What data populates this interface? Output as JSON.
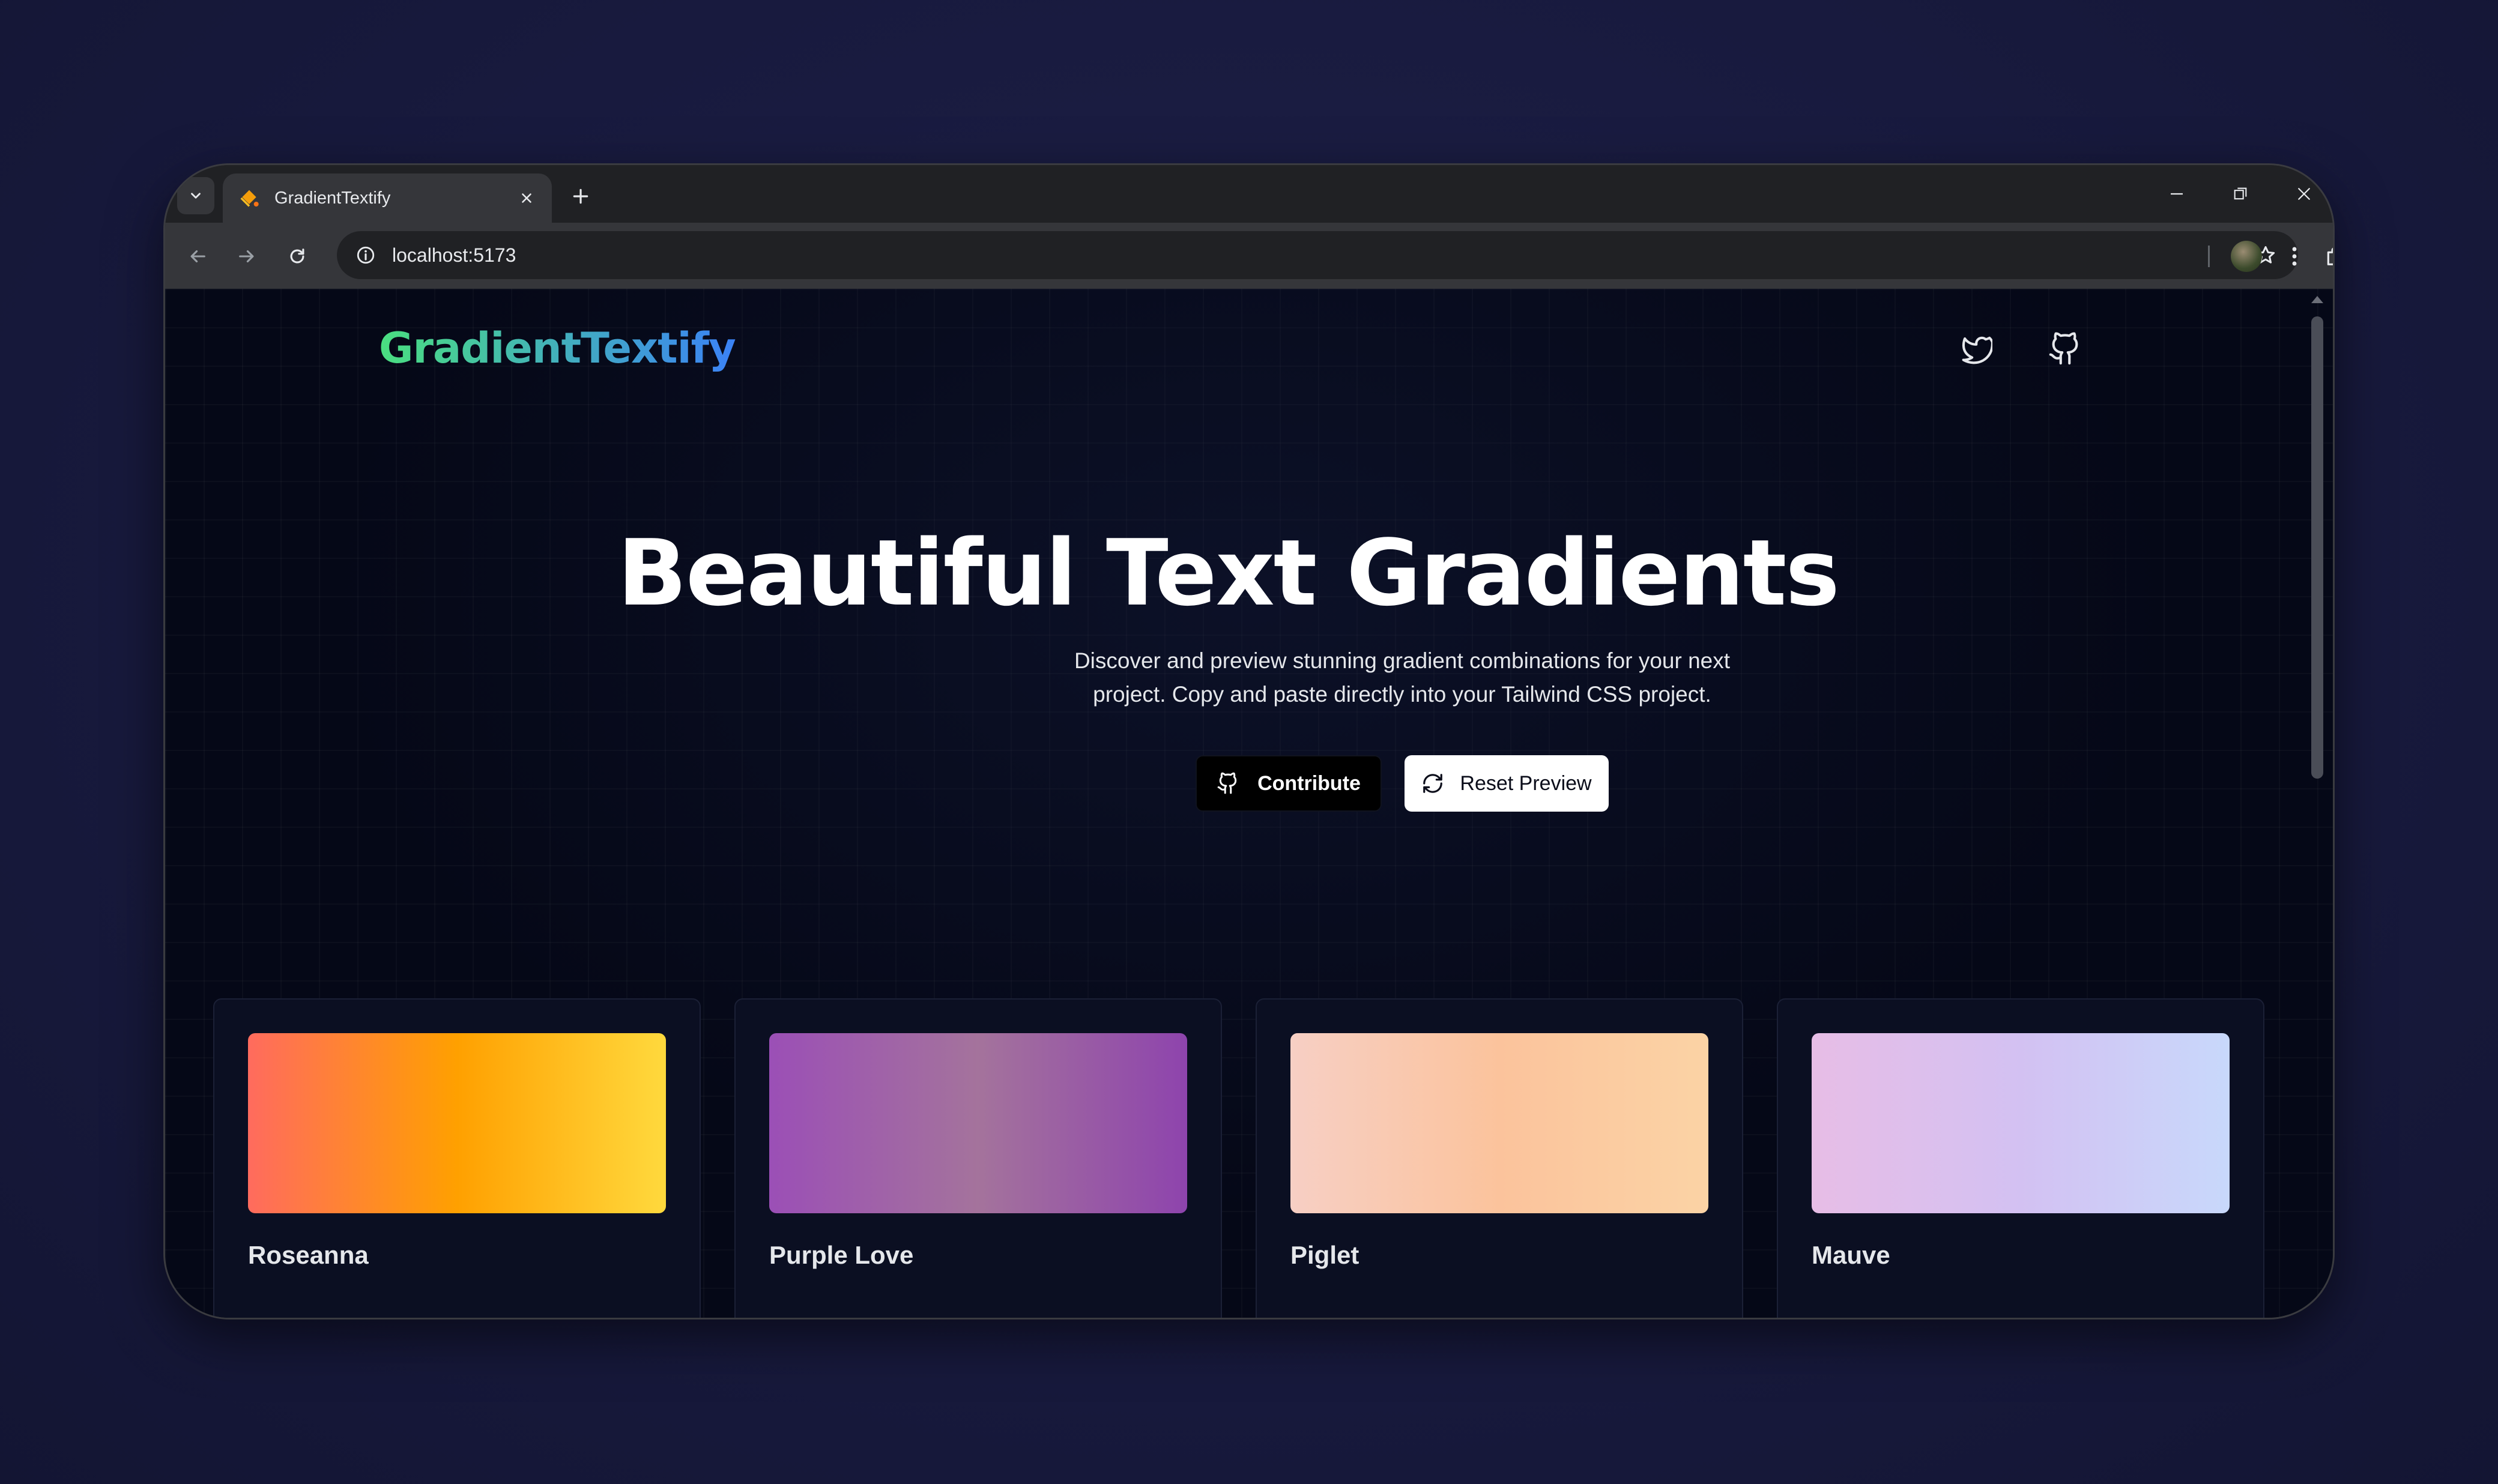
{
  "browser": {
    "tab_title": "GradientTextify",
    "url": "localhost:5173",
    "icons": [
      "tab-search-icon",
      "close-icon",
      "plus-icon",
      "minimize-icon",
      "restore-icon",
      "close-icon",
      "back-icon",
      "forward-icon",
      "reload-icon",
      "info-icon",
      "star-icon",
      "extensions-icon",
      "kebab-menu-icon"
    ]
  },
  "page": {
    "logo": "GradientTextify",
    "social_icons": [
      "twitter-icon",
      "github-icon"
    ],
    "hero": {
      "title": "Beautiful Text Gradients",
      "subtitle_line1": "Discover and preview stunning gradient combinations for your next",
      "subtitle_line2": "project. Copy and paste directly into your Tailwind CSS project."
    },
    "buttons": {
      "contribute": "Contribute",
      "reset": "Reset Preview"
    },
    "gradients": [
      {
        "name": "Roseanna",
        "colors": [
          "#ff6b5e",
          "#ffa000",
          "#ffd93d"
        ]
      },
      {
        "name": "Purple Love",
        "colors": [
          "#9b4fb6",
          "#a4739c",
          "#8e44ad"
        ]
      },
      {
        "name": "Piglet",
        "colors": [
          "#f7cfc4",
          "#fbc39c",
          "#fbd3a5"
        ]
      },
      {
        "name": "Mauve",
        "colors": [
          "#e7bde6",
          "#d3c1f2",
          "#c8d8fb"
        ]
      }
    ]
  },
  "colors": {
    "background": "#181a3e",
    "page_bg": "#050817",
    "logo_gradient": [
      "#4ade80",
      "#3b82f6"
    ]
  }
}
